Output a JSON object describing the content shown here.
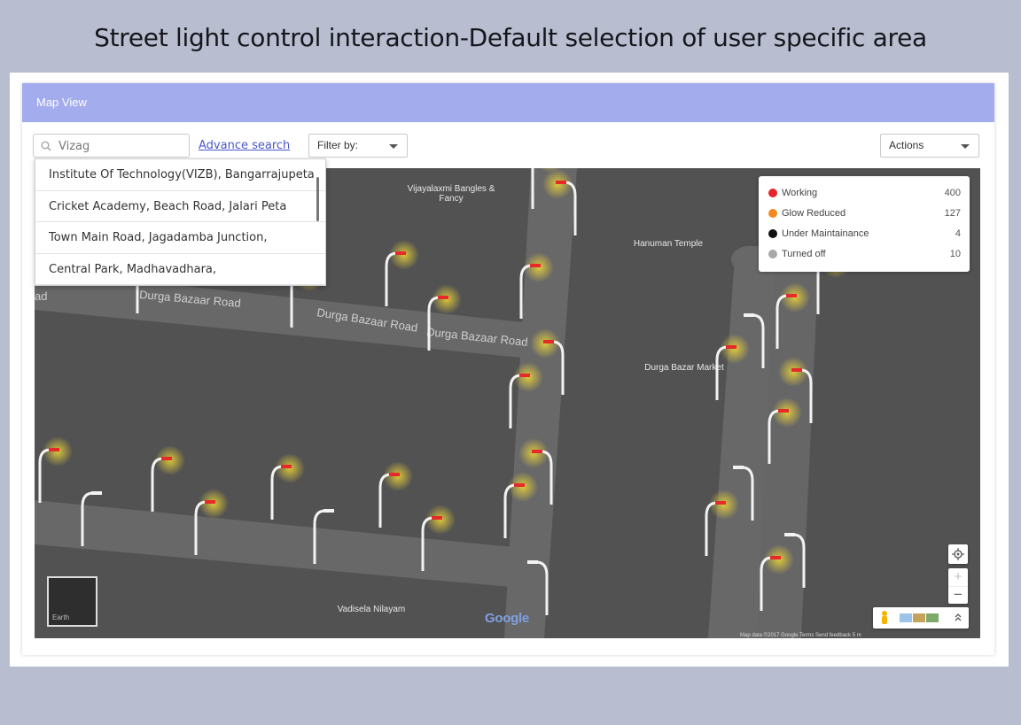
{
  "headline": "Street light control interaction-Default selection of user specific area",
  "card": {
    "title": "Map View"
  },
  "toolbar": {
    "search_value": "Vizag",
    "advance_search": "Advance search",
    "filter_label": "Filter by:",
    "actions_label": "Actions"
  },
  "search_suggestions": [
    "Institute Of Technology(VIZB), Bangarrajupeta",
    "Cricket Academy, Beach Road, Jalari Peta",
    "Town Main Road, Jagadamba Junction,",
    "Central Park, Madhavadhara,"
  ],
  "legend": [
    {
      "label": "Working",
      "count": "400",
      "color": "#e8242b"
    },
    {
      "label": "Glow Reduced",
      "count": "127",
      "color": "#f5891f"
    },
    {
      "label": "Under Maintainance",
      "count": "4",
      "color": "#111111"
    },
    {
      "label": "Turned off",
      "count": "10",
      "color": "#a8a8a8"
    }
  ],
  "map_labels": {
    "poi_bangles": "Vijayalaxmi Bangles & Fancy",
    "poi_hanuman": "Hanuman Temple",
    "poi_market": "Durga Bazar Market",
    "poi_vadisela": "Vadisela Nilayam",
    "road_1": "Durga Bazaar Road",
    "road_2": "Durga Bazaar Road",
    "road_3": "Durga Bazaar Road",
    "road_ad": "ad",
    "google": "Google",
    "earth": "Earth",
    "attribution": "Map data ©2017 Google    Terms    Send feedback    5 m"
  },
  "colors": {
    "header": "#a3acec",
    "link": "#4b56c9",
    "map": "#525252"
  }
}
